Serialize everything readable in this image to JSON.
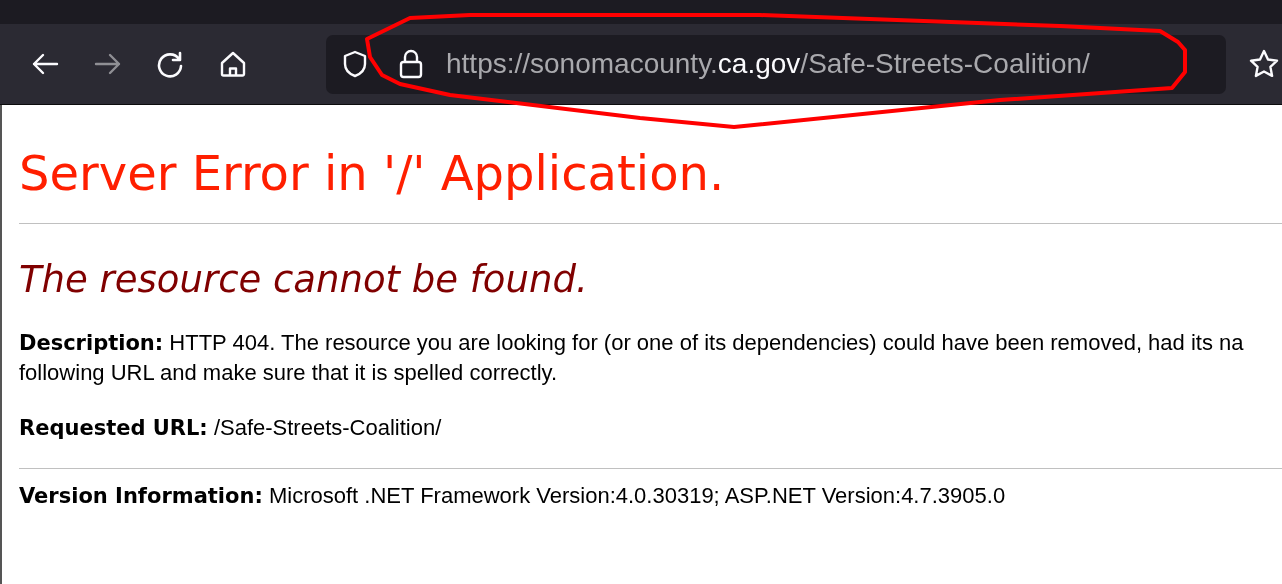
{
  "toolbar": {
    "buttons": [
      {
        "kind": "back",
        "disabled": false
      },
      {
        "kind": "forward",
        "disabled": true
      },
      {
        "kind": "reload",
        "disabled": false
      },
      {
        "kind": "home",
        "disabled": false
      }
    ],
    "address": {
      "prefix": "https://sonomacounty.",
      "domain": "ca.gov",
      "path": "/Safe-Streets-Coalition/"
    },
    "annotation": {
      "kind": "ellipse",
      "color": "#ff0000"
    }
  },
  "page": {
    "title": "Server Error in '/' Application.",
    "subtitle": "The resource cannot be found.",
    "blocks": [
      {
        "kind": "para",
        "lines": [
          "**Description:** HTTP 404. The resource you are looking for (or one of its dependencies) could have been removed, had its na",
          "following URL and make sure that it is spelled correctly."
        ]
      },
      {
        "kind": "para",
        "lines": [
          "**Requested URL:** /Safe-Streets-Coalition/"
        ]
      },
      {
        "kind": "rule"
      },
      {
        "kind": "para",
        "lines": [
          "**Version Information:** Microsoft .NET Framework Version:4.0.30319; ASP.NET Version:4.7.3905.0"
        ]
      }
    ]
  }
}
